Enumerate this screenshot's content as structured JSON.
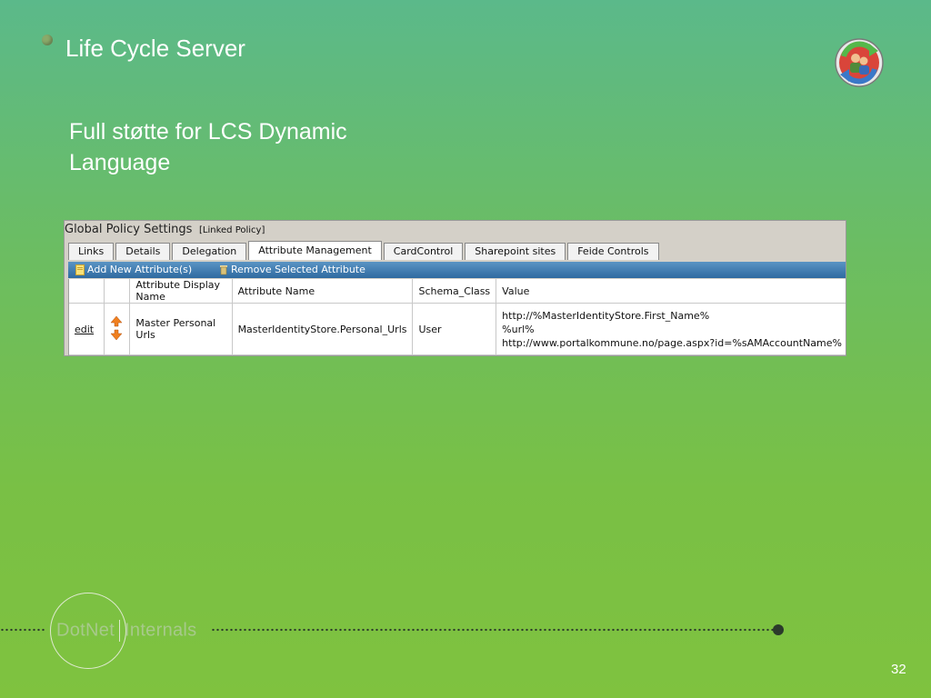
{
  "slide": {
    "title": "Life Cycle Server",
    "subtitle": "Full støtte for LCS Dynamic Language",
    "page_number": "32"
  },
  "screenshot": {
    "header_title": "Global Policy Settings",
    "header_tag": "[Linked Policy]",
    "tabs": [
      {
        "label": "Links",
        "active": false
      },
      {
        "label": "Details",
        "active": false
      },
      {
        "label": "Delegation",
        "active": false
      },
      {
        "label": "Attribute Management",
        "active": true
      },
      {
        "label": "CardControl",
        "active": false
      },
      {
        "label": "Sharepoint sites",
        "active": false
      },
      {
        "label": "Feide Controls",
        "active": false
      }
    ],
    "toolbar": {
      "add_label": "Add New Attribute(s)",
      "remove_label": "Remove Selected Attribute"
    },
    "table": {
      "headers": [
        "",
        "",
        "Attribute Display Name",
        "Attribute Name",
        "Schema_Class",
        "Value"
      ],
      "rows": [
        {
          "edit": "edit",
          "display_name": "Master Personal Urls",
          "attribute_name": "MasterIdentityStore.Personal_Urls",
          "schema_class": "User",
          "value_lines": [
            "http://%MasterIdentityStore.First_Name%",
            "%url%",
            "http://www.portalkommune.no/page.aspx?id=%sAMAccountName%"
          ]
        }
      ]
    }
  },
  "footer": {
    "brand_left": "DotNet",
    "brand_right": "Internals"
  },
  "icons": {
    "bullet": "bullet-dot-icon",
    "top_logo": "user-sync-logo-icon",
    "add": "new-document-icon",
    "remove": "trash-icon",
    "reorder": "up-down-arrows-icon"
  }
}
